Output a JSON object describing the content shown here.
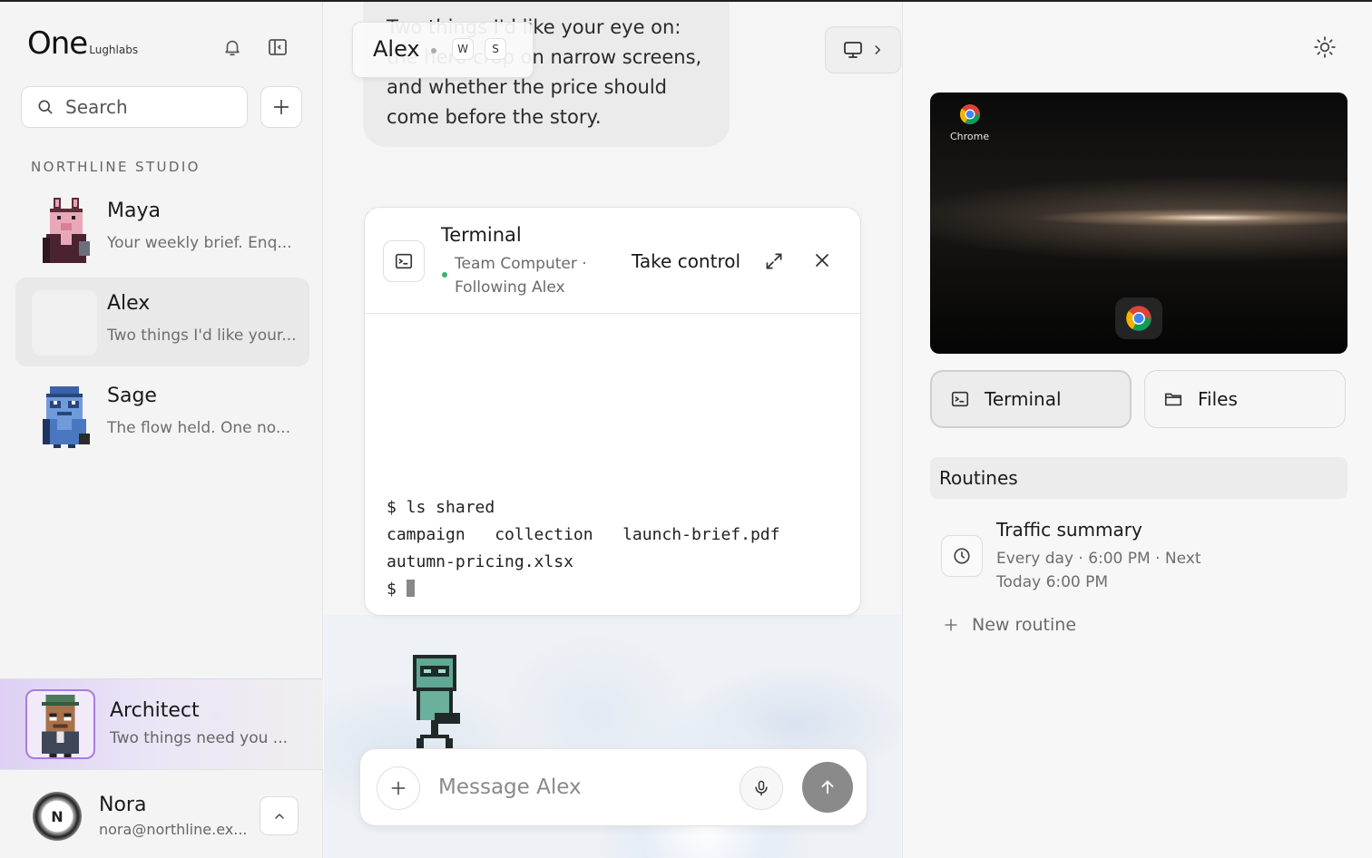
{
  "app": {
    "logo_main": "One",
    "logo_sub": "Lughlabs"
  },
  "sidebar": {
    "search_placeholder": "Search",
    "section_label": "NORTHLINE STUDIO",
    "contacts": [
      {
        "name": "Maya",
        "preview": "Your weekly brief. Enq..."
      },
      {
        "name": "Alex",
        "preview": "Two things I'd like your..."
      },
      {
        "name": "Sage",
        "preview": "The flow held. One no..."
      }
    ],
    "architect": {
      "name": "Architect",
      "preview": "Two things need you ..."
    },
    "user": {
      "initial": "N",
      "name": "Nora",
      "email": "nora@northline.ex..."
    }
  },
  "chat": {
    "header_name": "Alex",
    "keys": [
      "W",
      "S"
    ],
    "bubble_text": "Two things I'd like your eye on: the hero crop on narrow screens, and whether the price should come before the story.",
    "terminal": {
      "title": "Terminal",
      "subtitle": "Team Computer · Following Alex",
      "take_control": "Take control",
      "lines": [
        "$ ls shared",
        "campaign   collection   launch-brief.pdf",
        "autumn-pricing.xlsx",
        "$ "
      ]
    },
    "composer_placeholder": "Message Alex"
  },
  "right": {
    "preview_app_label": "Chrome",
    "buttons": {
      "terminal": "Terminal",
      "files": "Files"
    },
    "routines_heading": "Routines",
    "routine": {
      "title": "Traffic summary",
      "schedule": "Every day · 6:00 PM · Next Today 6:00 PM"
    },
    "new_routine": "New routine"
  },
  "colors": {
    "accent_purple": "#a97ce0",
    "status_green": "#3bb36a",
    "send_button": "#8a8a8a"
  }
}
